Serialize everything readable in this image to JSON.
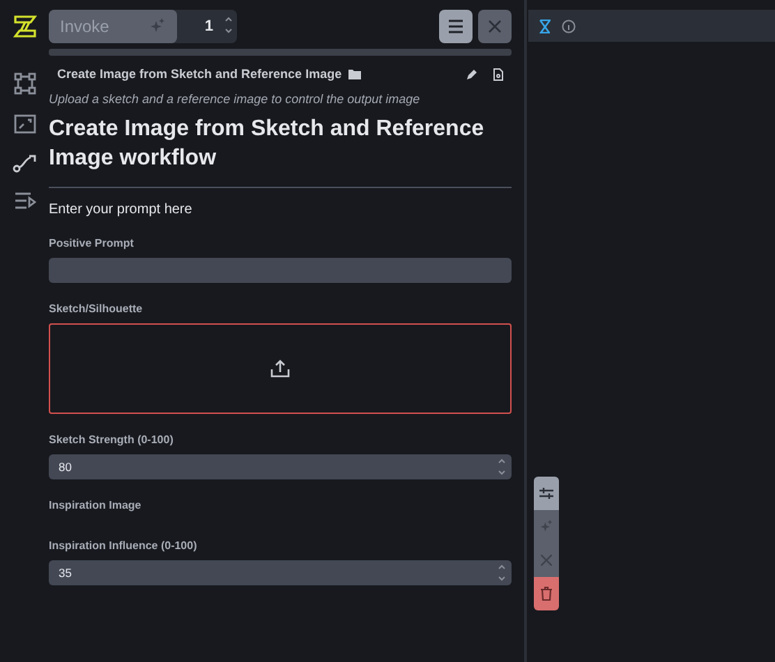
{
  "invoke": {
    "label": "Invoke",
    "disabled": true,
    "count": "1"
  },
  "progress": {
    "level": 0
  },
  "workflow": {
    "name": "Create Image from Sketch and Reference Image",
    "description": "Upload a sketch and a reference image to control the output image",
    "title": "Create Image from Sketch and Reference Image workflow",
    "section": "Enter your prompt here",
    "fields": [
      {
        "kind": "text",
        "label": "Positive Prompt"
      },
      {
        "kind": "image",
        "label": "Sketch/Silhouette",
        "invalid": true
      },
      {
        "kind": "number",
        "label": "Sketch Strength (0-100)",
        "value": "80"
      },
      {
        "kind": "none",
        "label": "Inspiration Image"
      },
      {
        "kind": "number",
        "label": "Inspiration Influence (0-100)",
        "value": "35"
      }
    ]
  },
  "right_tabs": [
    {
      "selected": true
    },
    {
      "selected": false
    }
  ],
  "floating_toolbar": [
    {
      "disabled": false
    },
    {
      "disabled": true
    },
    {
      "disabled": true
    },
    {
      "disabled": false
    }
  ]
}
